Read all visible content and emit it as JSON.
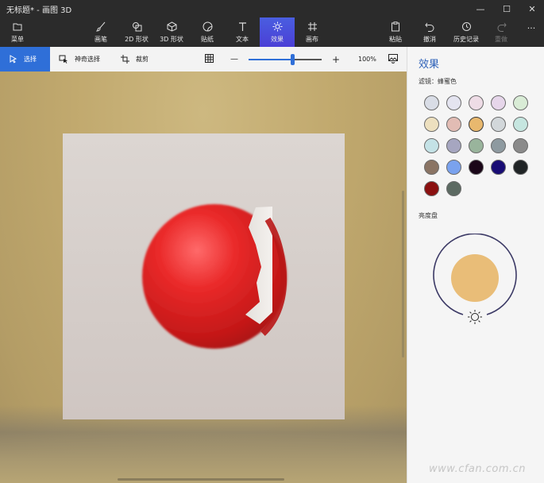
{
  "window": {
    "title": "无标题* - 画图 3D",
    "minimize": "—",
    "maximize": "☐",
    "close": "✕"
  },
  "toolbar": {
    "menu": "菜单",
    "brushes": "画笔",
    "shapes2d": "2D 形状",
    "shapes3d": "3D 形状",
    "stickers": "贴纸",
    "text": "文本",
    "effects": "效果",
    "canvas": "画布",
    "paste": "粘贴",
    "undo": "撤消",
    "history": "历史记录",
    "redo": "重做",
    "more": "···"
  },
  "subbar": {
    "select": "选择",
    "magic_select": "神奇选择",
    "crop": "裁剪",
    "zoom_minus": "—",
    "zoom_plus": "+",
    "zoom_value": "100%",
    "zoom_fraction": 0.6
  },
  "panel": {
    "title": "效果",
    "filter_label": "滤镜：蜂蜜色",
    "brightness_label": "亮度盘",
    "swatches": [
      "#d9dde6",
      "#e4e4f0",
      "#eedce6",
      "#e6d6ea",
      "#d9ecd6",
      "#ede0bf",
      "#e2bcb4",
      "#e8b86e",
      "#d2d7da",
      "#c6e6e0",
      "#c4e2e6",
      "#a6a6c0",
      "#99b49c",
      "#8e9aa0",
      "#8a8a8a",
      "#8a7464",
      "#7aa2ee",
      "#1a0618",
      "#180c74",
      "#202426",
      "#8a1010",
      "#5c6a62"
    ],
    "selected_swatch": 7,
    "accent_color": "#e9bd78"
  },
  "watermark": "www.cfan.com.cn"
}
